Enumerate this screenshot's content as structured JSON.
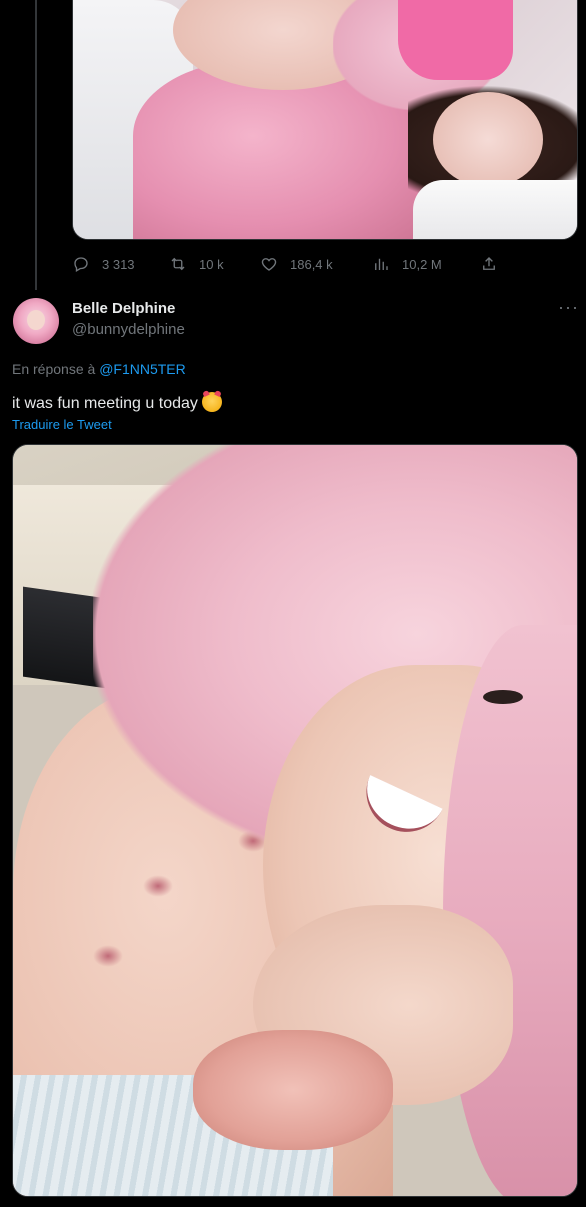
{
  "previous_tweet": {
    "stats": {
      "replies": "3 313",
      "retweets": "10 k",
      "likes": "186,4 k",
      "views": "10,2 M"
    }
  },
  "tweet": {
    "display_name": "Belle Delphine",
    "handle": "@bunnydelphine",
    "more_icon": "more-icon",
    "reply_prefix": "En réponse à",
    "reply_to": "@F1NN5TER",
    "text": "it was fun meeting u today",
    "emoji": "smiling-face-with-hearts",
    "translate_label": "Traduire le Tweet"
  },
  "colors": {
    "background": "#000000",
    "text": "#e7e9ea",
    "muted": "#71767b",
    "link": "#1d9bf0",
    "border": "#2f3336"
  }
}
